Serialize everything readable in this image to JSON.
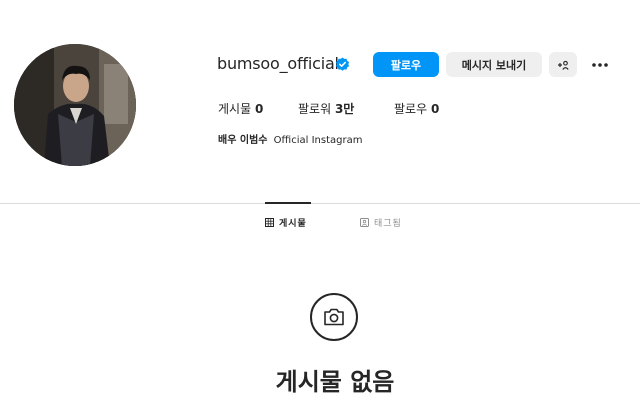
{
  "profile": {
    "username": "bumsoo_official",
    "verified": true,
    "buttons": {
      "follow": "팔로우",
      "message": "메시지 보내기",
      "suggest": "+ዲ"
    },
    "stats": {
      "posts_label": "게시물",
      "posts_value": "0",
      "followers_label": "팔로워",
      "followers_value": "3만",
      "following_label": "팔로우",
      "following_value": "0"
    },
    "bio": {
      "name": "배우 이범수",
      "text": "Official Instagram"
    }
  },
  "tabs": [
    {
      "label": "게시물",
      "icon": "grid-icon",
      "active": true
    },
    {
      "label": "태그됨",
      "icon": "tag-icon",
      "active": false
    }
  ],
  "empty_state": {
    "icon": "camera-icon",
    "title": "게시물 없음"
  },
  "colors": {
    "accent": "#0095f6",
    "text": "#262626",
    "muted": "#8e8e8e",
    "button_bg": "#efefef",
    "divider": "#dbdbdb"
  }
}
